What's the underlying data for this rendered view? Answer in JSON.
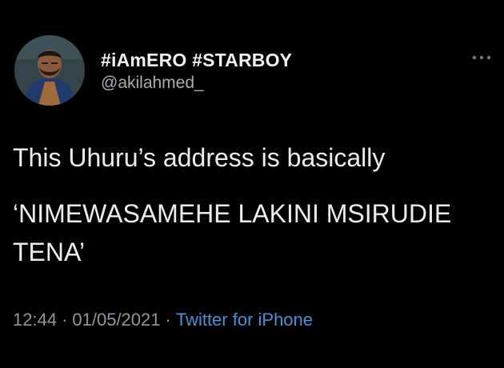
{
  "user": {
    "display_name": "#iAmERO #STARBOY",
    "handle": "@akilahmed_",
    "avatar_icon": "profile-photo"
  },
  "tweet": {
    "line_1": "This Uhuru’s address is basically",
    "line_2": "‘NIMEWASAMEHE LAKINI MSIRUDIE TENA’",
    "time": "12:44",
    "date": "01/05/2021",
    "separator": "·",
    "source": "Twitter for iPhone"
  },
  "controls": {
    "more_icon": "more-horizontal-icon"
  },
  "colors": {
    "background": "#000000",
    "text": "#ececec",
    "secondary": "#8e959c",
    "link": "#4a90d9"
  }
}
